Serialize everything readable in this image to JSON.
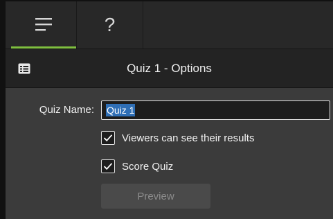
{
  "tabs": {
    "menu_icon": "hamburger-icon",
    "help_label": "?"
  },
  "header": {
    "icon": "list-panel-icon",
    "title": "Quiz 1 - Options"
  },
  "form": {
    "quiz_name_label": "Quiz Name:",
    "quiz_name_value": "Quiz 1",
    "viewers_results_label": "Viewers can see their results",
    "viewers_results_checked": true,
    "score_quiz_label": "Score Quiz",
    "score_quiz_checked": true,
    "preview_label": "Preview"
  },
  "colors": {
    "accent": "#7fbf3f",
    "selection": "#2f6fb6",
    "panel_bg": "#3b3b3b"
  }
}
